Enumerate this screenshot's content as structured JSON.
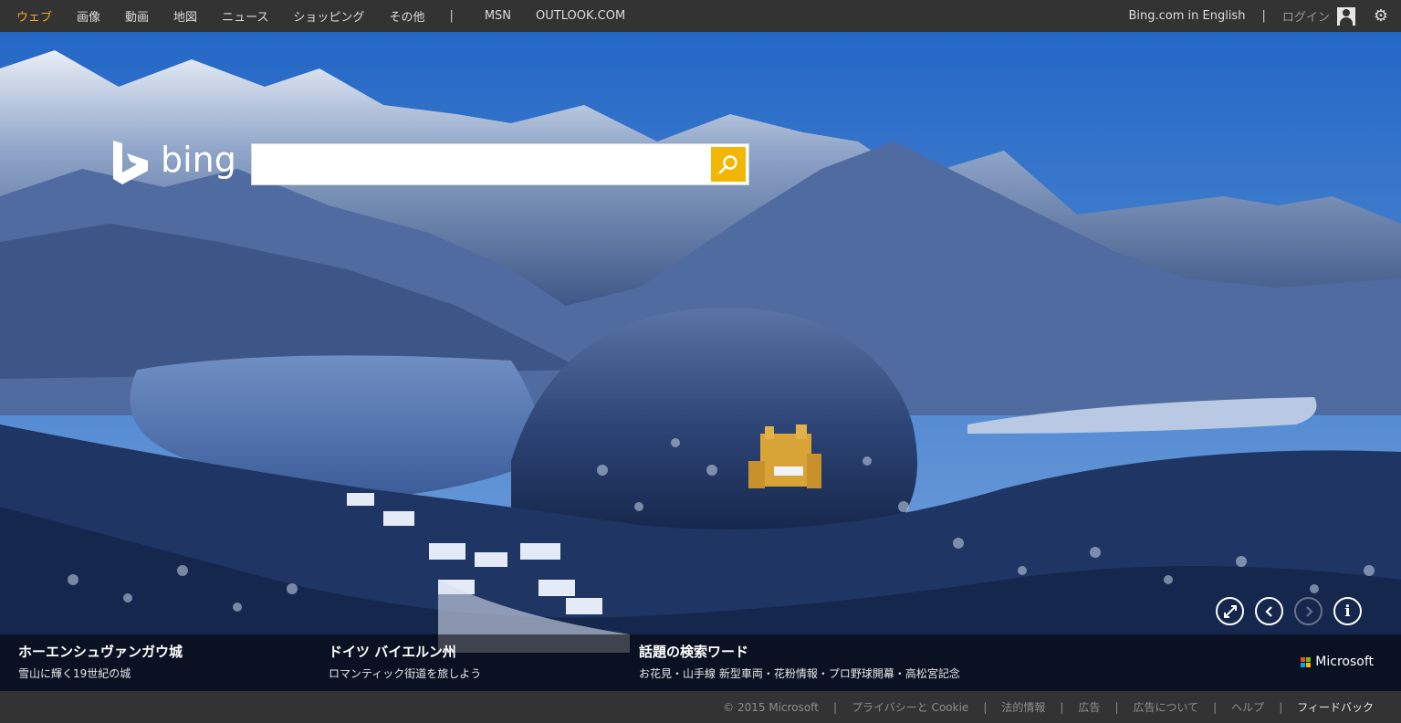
{
  "nav": {
    "items": [
      {
        "label": "ウェブ",
        "active": true
      },
      {
        "label": "画像",
        "active": false
      },
      {
        "label": "動画",
        "active": false
      },
      {
        "label": "地図",
        "active": false
      },
      {
        "label": "ニュース",
        "active": false
      },
      {
        "label": "ショッピング",
        "active": false
      },
      {
        "label": "その他",
        "active": false
      }
    ],
    "separator": "|",
    "extra": [
      "MSN",
      "OUTLOOK.COM"
    ],
    "active_color": "#f6a821"
  },
  "account": {
    "language_link": "Bing.com in English",
    "separator": "|",
    "login_label": "ログイン",
    "user_icon": "user-icon",
    "settings_icon": "gear-icon"
  },
  "logo": {
    "word": "bing"
  },
  "search": {
    "value": "",
    "placeholder": "",
    "button_icon": "search-icon",
    "button_color": "#f2b705"
  },
  "image_controls": [
    {
      "name": "fullscreen-icon",
      "enabled": true
    },
    {
      "name": "previous-image-icon",
      "enabled": true
    },
    {
      "name": "next-image-icon",
      "enabled": false
    },
    {
      "name": "info-icon",
      "enabled": true
    }
  ],
  "captions": [
    {
      "title": "ホーエンシュヴァンガウ城",
      "subtitle": "雪山に輝く19世紀の城"
    },
    {
      "title": "ドイツ バイエルン州",
      "subtitle": "ロマンティック街道を旅しよう"
    },
    {
      "title": "話題の検索ワード",
      "subtitle": "お花見・山手線 新型車両・花粉情報・プロ野球開幕・高松宮記念"
    }
  ],
  "microsoft": {
    "label": "Microsoft",
    "colors": [
      "#f25022",
      "#7fba00",
      "#00a4ef",
      "#ffb900"
    ]
  },
  "footer": {
    "links": [
      {
        "label": "© 2015 Microsoft",
        "highlight": false
      },
      {
        "label": "プライバシーと Cookie",
        "highlight": false
      },
      {
        "label": "法的情報",
        "highlight": false
      },
      {
        "label": "広告",
        "highlight": false
      },
      {
        "label": "広告について",
        "highlight": false
      },
      {
        "label": "ヘルプ",
        "highlight": false
      },
      {
        "label": "フィードバック",
        "highlight": true
      }
    ],
    "separator": "|"
  }
}
